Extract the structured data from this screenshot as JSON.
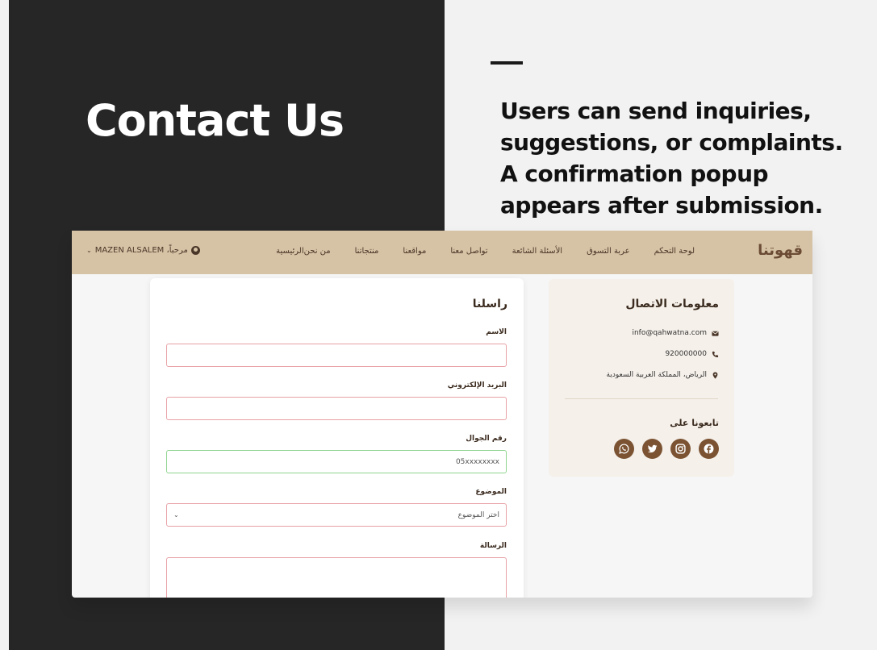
{
  "slide": {
    "title": "Contact Us",
    "description": "Users can send inquiries, suggestions, or complaints. A confirmation popup appears after submission."
  },
  "app": {
    "brand": "قهوتنا",
    "nav": [
      "الرئيسية",
      "من نحن",
      "منتجاتنا",
      "مواقعنا",
      "تواصل معنا",
      "الأسئلة الشائعة",
      "عربة التسوق",
      "لوحة التحكم"
    ],
    "user_greeting": "مرحباً، MAZEN ALSALEM"
  },
  "form": {
    "title": "راسلنا",
    "name_label": "الاسم",
    "email_label": "البريد الإلكتروني",
    "phone_label": "رقم الجوال",
    "phone_value": "05xxxxxxxx",
    "subject_label": "الموضوع",
    "subject_value": "اختر الموضوع",
    "message_label": "الرسالة"
  },
  "contact_info": {
    "title": "معلومات الاتصال",
    "email": "info@qahwatna.com",
    "phone": "920000000",
    "address": "الرياض، المملكة العربية السعودية",
    "follow_title": "تابعونا على",
    "socials": [
      "facebook-icon",
      "instagram-icon",
      "twitter-icon",
      "whatsapp-icon"
    ]
  },
  "colors": {
    "navbar": "#d6c3a5",
    "accent": "#7b5333",
    "invalid_border": "#e8a1a6",
    "valid_border": "#8fd48f"
  }
}
